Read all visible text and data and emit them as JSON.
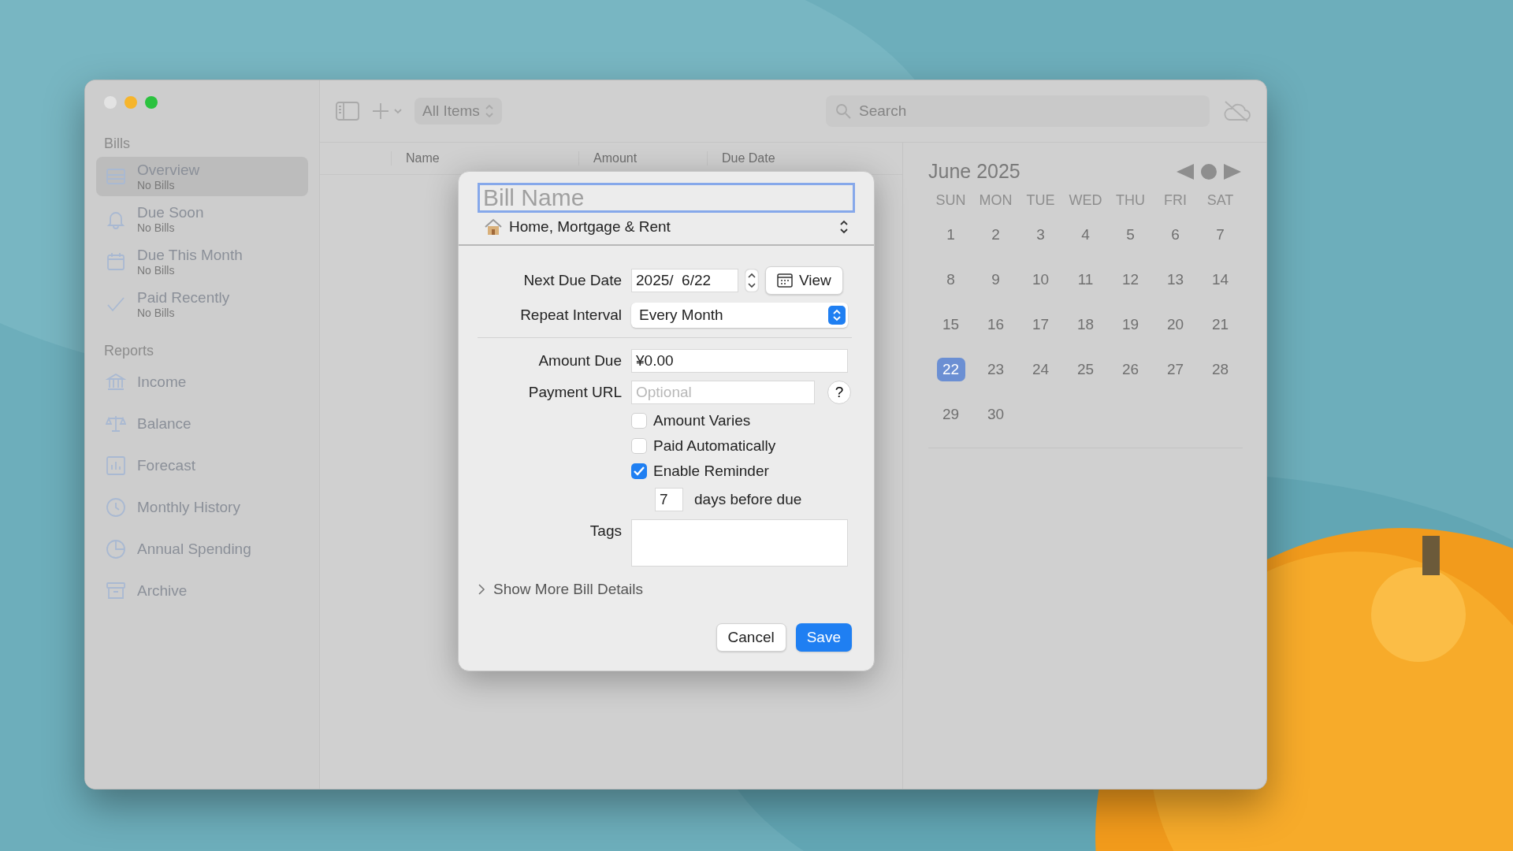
{
  "toolbar": {
    "view_picker": "All Items",
    "search": {
      "placeholder": "Search"
    }
  },
  "sidebar": {
    "sections": [
      {
        "title": "Bills",
        "items": [
          {
            "label": "Overview",
            "subtitle": "No Bills",
            "selected": true
          },
          {
            "label": "Due Soon",
            "subtitle": "No Bills",
            "selected": false
          },
          {
            "label": "Due This Month",
            "subtitle": "No Bills",
            "selected": false
          },
          {
            "label": "Paid Recently",
            "subtitle": "No Bills",
            "selected": false
          }
        ]
      },
      {
        "title": "Reports",
        "items": [
          {
            "label": "Income",
            "selected": false
          },
          {
            "label": "Balance",
            "selected": false
          },
          {
            "label": "Forecast",
            "selected": false
          },
          {
            "label": "Monthly History",
            "selected": false
          },
          {
            "label": "Annual Spending",
            "selected": false
          },
          {
            "label": "Archive",
            "selected": false
          }
        ]
      }
    ]
  },
  "table": {
    "columns": [
      "Name",
      "Amount",
      "Due Date"
    ]
  },
  "calendar": {
    "month": "June 2025",
    "weekdays": [
      "SUN",
      "MON",
      "TUE",
      "WED",
      "THU",
      "FRI",
      "SAT"
    ],
    "days": [
      {
        "label": "1",
        "selected": false
      },
      {
        "label": "2",
        "selected": false
      },
      {
        "label": "3",
        "selected": false
      },
      {
        "label": "4",
        "selected": false
      },
      {
        "label": "5",
        "selected": false
      },
      {
        "label": "6",
        "selected": false
      },
      {
        "label": "7",
        "selected": false
      },
      {
        "label": "8",
        "selected": false
      },
      {
        "label": "9",
        "selected": false
      },
      {
        "label": "10",
        "selected": false
      },
      {
        "label": "11",
        "selected": false
      },
      {
        "label": "12",
        "selected": false
      },
      {
        "label": "13",
        "selected": false
      },
      {
        "label": "14",
        "selected": false
      },
      {
        "label": "15",
        "selected": false
      },
      {
        "label": "16",
        "selected": false
      },
      {
        "label": "17",
        "selected": false
      },
      {
        "label": "18",
        "selected": false
      },
      {
        "label": "19",
        "selected": false
      },
      {
        "label": "20",
        "selected": false
      },
      {
        "label": "21",
        "selected": false
      },
      {
        "label": "22",
        "selected": true
      },
      {
        "label": "23",
        "selected": false
      },
      {
        "label": "24",
        "selected": false
      },
      {
        "label": "25",
        "selected": false
      },
      {
        "label": "26",
        "selected": false
      },
      {
        "label": "27",
        "selected": false
      },
      {
        "label": "28",
        "selected": false
      },
      {
        "label": "29",
        "selected": false
      },
      {
        "label": "30",
        "selected": false
      }
    ]
  },
  "dialog": {
    "bill_name": {
      "placeholder": "Bill Name"
    },
    "category": "Home, Mortgage & Rent",
    "next_due_date": {
      "label": "Next Due Date",
      "value": "2025/  6/22",
      "view_button": "View"
    },
    "repeat_interval": {
      "label": "Repeat Interval",
      "value": "Every Month"
    },
    "amount_due": {
      "label": "Amount Due",
      "value": "¥0.00"
    },
    "payment_url": {
      "label": "Payment URL",
      "placeholder": "Optional",
      "help": "?"
    },
    "checkboxes": [
      {
        "label": "Amount Varies",
        "checked": false
      },
      {
        "label": "Paid Automatically",
        "checked": false
      },
      {
        "label": "Enable Reminder",
        "checked": true
      }
    ],
    "reminder": {
      "value": "7",
      "suffix": "days before due"
    },
    "tags": {
      "label": "Tags"
    },
    "more_details": {
      "label": "Show More Bill Details",
      "expanded": false
    },
    "buttons": {
      "cancel": "Cancel",
      "save": "Save"
    }
  }
}
